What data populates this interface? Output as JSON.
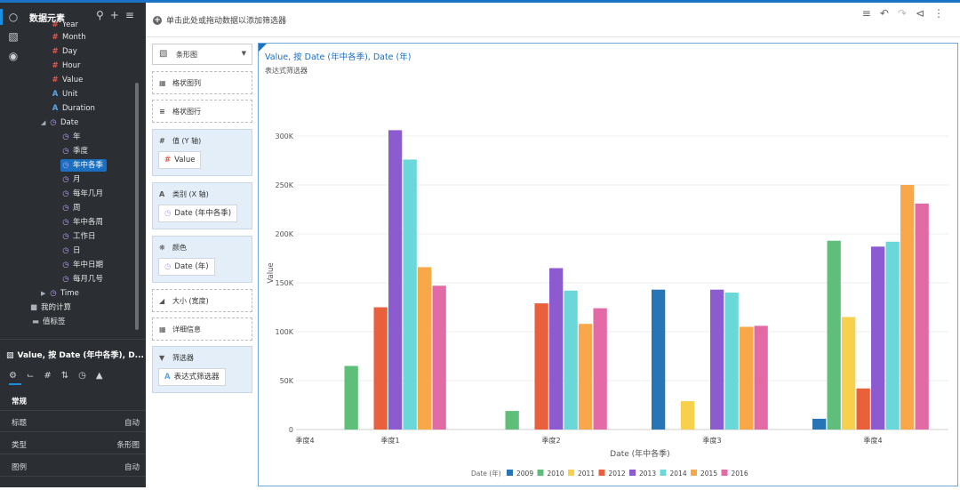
{
  "left_panel": {
    "title": "数据元素",
    "tree": [
      {
        "label": "Year",
        "icon": "hash",
        "indent": 0,
        "top": 0
      },
      {
        "label": "Month",
        "icon": "hash",
        "indent": 0,
        "top": 14
      },
      {
        "label": "Day",
        "icon": "hash",
        "indent": 0,
        "top": 30
      },
      {
        "label": "Hour",
        "icon": "hash",
        "indent": 0,
        "top": 46
      },
      {
        "label": "Value",
        "icon": "hash",
        "indent": 0,
        "top": 62
      },
      {
        "label": "Unit",
        "icon": "a",
        "indent": 0,
        "top": 78
      },
      {
        "label": "Duration",
        "icon": "a",
        "indent": 0,
        "top": 94
      },
      {
        "label": "Date",
        "icon": "clock",
        "indent": 0,
        "top": 110,
        "caret": "◢"
      },
      {
        "label": "年",
        "icon": "clock",
        "indent": 1,
        "top": 126
      },
      {
        "label": "季度",
        "icon": "clock",
        "indent": 1,
        "top": 142
      },
      {
        "label": "年中各季",
        "icon": "clock",
        "indent": 1,
        "top": 158,
        "selected": true
      },
      {
        "label": "月",
        "icon": "clock",
        "indent": 1,
        "top": 174
      },
      {
        "label": "每年几月",
        "icon": "clock",
        "indent": 1,
        "top": 190
      },
      {
        "label": "周",
        "icon": "clock",
        "indent": 1,
        "top": 206
      },
      {
        "label": "年中各周",
        "icon": "clock",
        "indent": 1,
        "top": 222
      },
      {
        "label": "工作日",
        "icon": "clock",
        "indent": 1,
        "top": 238
      },
      {
        "label": "日",
        "icon": "clock",
        "indent": 1,
        "top": 254
      },
      {
        "label": "年中日期",
        "icon": "clock",
        "indent": 1,
        "top": 270
      },
      {
        "label": "每月几号",
        "icon": "clock",
        "indent": 1,
        "top": 286
      },
      {
        "label": "Time",
        "icon": "clock",
        "indent": 0,
        "top": 302,
        "caret": "▶"
      },
      {
        "label": "我的计算",
        "icon": "folder",
        "indent": -1,
        "top": 318,
        "caret": "▶"
      },
      {
        "label": "值标签",
        "icon": "tag",
        "indent": -1,
        "top": 334
      }
    ],
    "props": {
      "title": "Value, 按 Date (年中各季), D...",
      "rows": [
        {
          "key": "常规",
          "value": "",
          "section": true
        },
        {
          "key": "标题",
          "value": "自动"
        },
        {
          "key": "类型",
          "value": "条形图"
        },
        {
          "key": "图例",
          "value": "自动"
        }
      ]
    }
  },
  "toolbar": {
    "add_filter_text": "单击此处或拖动数据以添加筛选器"
  },
  "shelves": {
    "chart_type": "条形图",
    "grid_columns": "格状图列",
    "grid_rows": "格状图行",
    "value_axis": {
      "label": "值 (Y 轴)",
      "pill": "Value"
    },
    "category_axis": {
      "label": "类别 (X 轴)",
      "pill": "Date (年中各季)"
    },
    "color": {
      "label": "颜色",
      "pill": "Date (年)"
    },
    "size": "大小 (宽度)",
    "detail": "详细信息",
    "filter": {
      "label": "筛选器",
      "pill": "表达式筛选器"
    }
  },
  "panel": {
    "title": "Value, 按 Date (年中各季), Date (年)",
    "subtitle": "表达式筛选器"
  },
  "chart_data": {
    "type": "bar",
    "categories": [
      "季度4",
      "季度1",
      "季度2",
      "季度3",
      "季度4"
    ],
    "xlabel": "Date (年中各季)",
    "ylabel": "Value",
    "ylim": [
      0,
      320000
    ],
    "yticks": [
      0,
      50000,
      100000,
      150000,
      200000,
      250000,
      300000
    ],
    "ytick_labels": [
      "0",
      "50K",
      "100K",
      "150K",
      "200K",
      "250K",
      "300K"
    ],
    "legend_title": "Date (年)",
    "legend_position": "bottom",
    "grid": true,
    "series": [
      {
        "name": "2009",
        "color": "#2775b6",
        "values": [
          null,
          null,
          null,
          143000,
          11000
        ]
      },
      {
        "name": "2010",
        "color": "#5fbf7a",
        "values": [
          null,
          65000,
          19000,
          null,
          193000
        ]
      },
      {
        "name": "2011",
        "color": "#f7d14c",
        "values": [
          null,
          null,
          null,
          29000,
          115000
        ]
      },
      {
        "name": "2012",
        "color": "#e8613c",
        "values": [
          null,
          125000,
          129000,
          null,
          42000
        ]
      },
      {
        "name": "2013",
        "color": "#8c5bd0",
        "values": [
          null,
          306000,
          165000,
          143000,
          187000
        ]
      },
      {
        "name": "2014",
        "color": "#6ad8d8",
        "values": [
          null,
          276000,
          142000,
          140000,
          192000
        ]
      },
      {
        "name": "2015",
        "color": "#f9a849",
        "values": [
          null,
          166000,
          108000,
          105000,
          250000
        ]
      },
      {
        "name": "2016",
        "color": "#e26aa5",
        "values": [
          null,
          147000,
          124000,
          106000,
          231000
        ]
      }
    ]
  }
}
